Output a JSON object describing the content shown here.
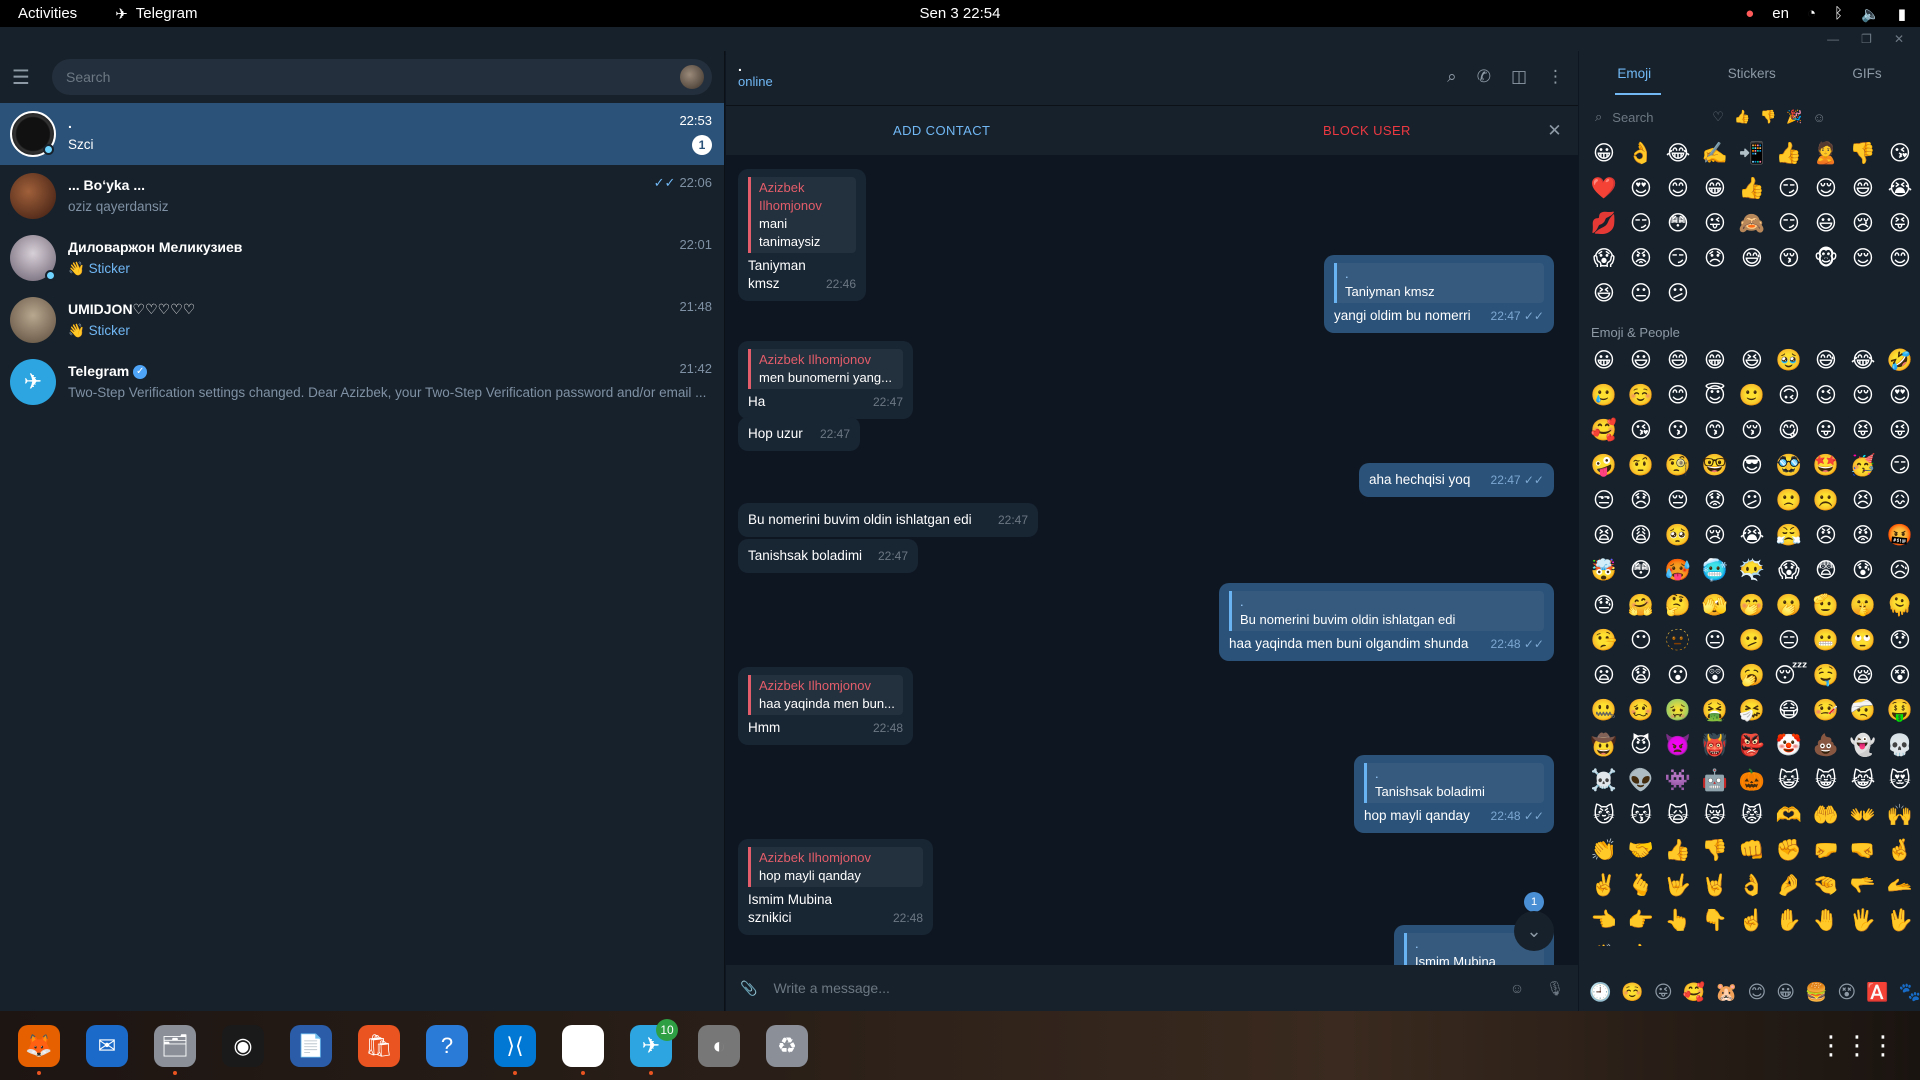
{
  "topbar": {
    "activities": "Activities",
    "app_name": "Telegram",
    "clock": "Sen 3  22:54",
    "lang": "en",
    "notif_count": "10"
  },
  "search": {
    "placeholder": "Search"
  },
  "chats": [
    {
      "name": ".",
      "preview": "Szci",
      "time": "22:53",
      "badge": "1",
      "active": true
    },
    {
      "name": "... Bo‘yka ...",
      "preview": "oziz qayerdansiz",
      "time": "22:06"
    },
    {
      "name": "Диловаржон Меликузиев",
      "preview_accent": "Sticker",
      "preview_emoji": "👋",
      "time": "22:01"
    },
    {
      "name": "UMIDJON♡♡♡♡♡",
      "preview_accent": "Sticker",
      "preview_emoji": "👋",
      "time": "21:48"
    },
    {
      "name": "Telegram",
      "preview": "Two-Step Verification settings changed. Dear Azizbek, your Two-Step Verification password and/or email ...",
      "time": "21:42"
    }
  ],
  "chat_header": {
    "title": ".",
    "status": "online"
  },
  "actionbar": {
    "add_contact": "ADD CONTACT",
    "block_user": "BLOCK USER"
  },
  "messages": [
    {
      "dir": "in",
      "reply_name": "Azizbek Ilhomjonov",
      "reply_text": "mani tanimaysiz",
      "text": "Taniyman kmsz",
      "time": "22:46"
    },
    {
      "dir": "out",
      "reply_name": ".",
      "reply_text": "Taniyman kmsz",
      "text": "yangi oldim bu nomerri",
      "time": "22:47"
    },
    {
      "dir": "in",
      "reply_name": "Azizbek Ilhomjonov",
      "reply_text": "men bunomerni yang...",
      "text": "Ha",
      "time": "22:47"
    },
    {
      "dir": "in",
      "text": "Hop uzur",
      "time": "22:47"
    },
    {
      "dir": "out",
      "text": "aha hechqisi yoq",
      "time": "22:47"
    },
    {
      "dir": "in",
      "text": "Bu nomerini buvim oldin ishlatgan edi",
      "time": "22:47"
    },
    {
      "dir": "in",
      "text": "Tanishsak boladimi",
      "time": "22:47"
    },
    {
      "dir": "out",
      "reply_name": ".",
      "reply_text": "Bu nomerini buvim oldin ishlatgan edi",
      "text": "haa yaqinda men buni olgandim shunda",
      "time": "22:48"
    },
    {
      "dir": "in",
      "reply_name": "Azizbek Ilhomjonov",
      "reply_text": "haa yaqinda men bun...",
      "text": "Hmm",
      "time": "22:48"
    },
    {
      "dir": "out",
      "reply_name": ".",
      "reply_text": "Tanishsak boladimi",
      "text": "hop mayli qanday",
      "time": "22:48"
    },
    {
      "dir": "in",
      "reply_name": "Azizbek Ilhomjonov",
      "reply_text": "hop mayli qanday",
      "text": "Ismim Mubina sznikici",
      "time": "22:48"
    },
    {
      "dir": "out",
      "reply_name": ".",
      "reply_text": "Ismim Mubina sznikici",
      "text": "",
      "time": ""
    }
  ],
  "scroll_badge": "1",
  "composer": {
    "placeholder": "Write a message..."
  },
  "emoji_panel": {
    "tabs": [
      "Emoji",
      "Stickers",
      "GIFs"
    ],
    "search_placeholder": "Search",
    "section_title": "Emoji & People",
    "recent": [
      "😀",
      "👌",
      "😂",
      "✍️",
      "📲",
      "👍",
      "🙎",
      "👎",
      "😘",
      "❤️",
      "😍",
      "😊",
      "😁",
      "👍",
      "😏",
      "😌",
      "😄",
      "😭",
      "💋",
      "😏",
      "😳",
      "😜",
      "🙈",
      "😏",
      "😃",
      "😢",
      "😝",
      "😱",
      "😡",
      "😏",
      "😞",
      "😅",
      "😚",
      "🐵",
      "😌",
      "😊",
      "😆",
      "😐",
      "😕"
    ],
    "people": [
      "😀",
      "😃",
      "😄",
      "😁",
      "😆",
      "🥹",
      "😅",
      "😂",
      "🤣",
      "🥲",
      "☺️",
      "😊",
      "😇",
      "🙂",
      "🙃",
      "😉",
      "😌",
      "😍",
      "🥰",
      "😘",
      "😗",
      "😙",
      "😚",
      "😋",
      "😛",
      "😝",
      "😜",
      "🤪",
      "🤨",
      "🧐",
      "🤓",
      "😎",
      "🥸",
      "🤩",
      "🥳",
      "😏",
      "😒",
      "😞",
      "😔",
      "😟",
      "😕",
      "🙁",
      "☹️",
      "😣",
      "😖",
      "😫",
      "😩",
      "🥺",
      "😢",
      "😭",
      "😤",
      "😠",
      "😡",
      "🤬",
      "🤯",
      "😳",
      "🥵",
      "🥶",
      "😶‍🌫️",
      "😱",
      "😨",
      "😰",
      "😥",
      "😓",
      "🤗",
      "🤔",
      "🫣",
      "🤭",
      "🫢",
      "🫡",
      "🤫",
      "🫠",
      "🤥",
      "😶",
      "🫥",
      "😐",
      "🫤",
      "😑",
      "😬",
      "🙄",
      "😯",
      "😦",
      "😧",
      "😮",
      "😲",
      "🥱",
      "😴",
      "🤤",
      "😪",
      "😵",
      "🤐",
      "🥴",
      "🤢",
      "🤮",
      "🤧",
      "😷",
      "🤒",
      "🤕",
      "🤑",
      "🤠",
      "😈",
      "👿",
      "👹",
      "👺",
      "🤡",
      "💩",
      "👻",
      "💀",
      "☠️",
      "👽",
      "👾",
      "🤖",
      "🎃",
      "😺",
      "😸",
      "😹",
      "😻",
      "😼",
      "😽",
      "🙀",
      "😿",
      "😾",
      "🫶",
      "🤲",
      "👐",
      "🙌",
      "👏",
      "🤝",
      "👍",
      "👎",
      "👊",
      "✊",
      "🤛",
      "🤜",
      "🤞",
      "✌️",
      "🫰",
      "🤟",
      "🤘",
      "👌",
      "🤌",
      "🤏",
      "🫳",
      "🫴",
      "👈",
      "👉",
      "👆",
      "👇",
      "☝️",
      "✋",
      "🤚",
      "🖐️",
      "🖖",
      "👋",
      "🤙"
    ],
    "footer": [
      "🕘",
      "☺️",
      "😜",
      "🥰",
      "🐹",
      "😊",
      "😀",
      "🍔",
      "😵",
      "🅰️",
      "🐾"
    ]
  },
  "dock": [
    "Firefox",
    "Thunderbird",
    "Files",
    "Rhythmbox",
    "Writer",
    "App Center",
    "Help",
    "VS Code",
    "Chrome",
    "Telegram",
    "Disks",
    "Trash"
  ]
}
